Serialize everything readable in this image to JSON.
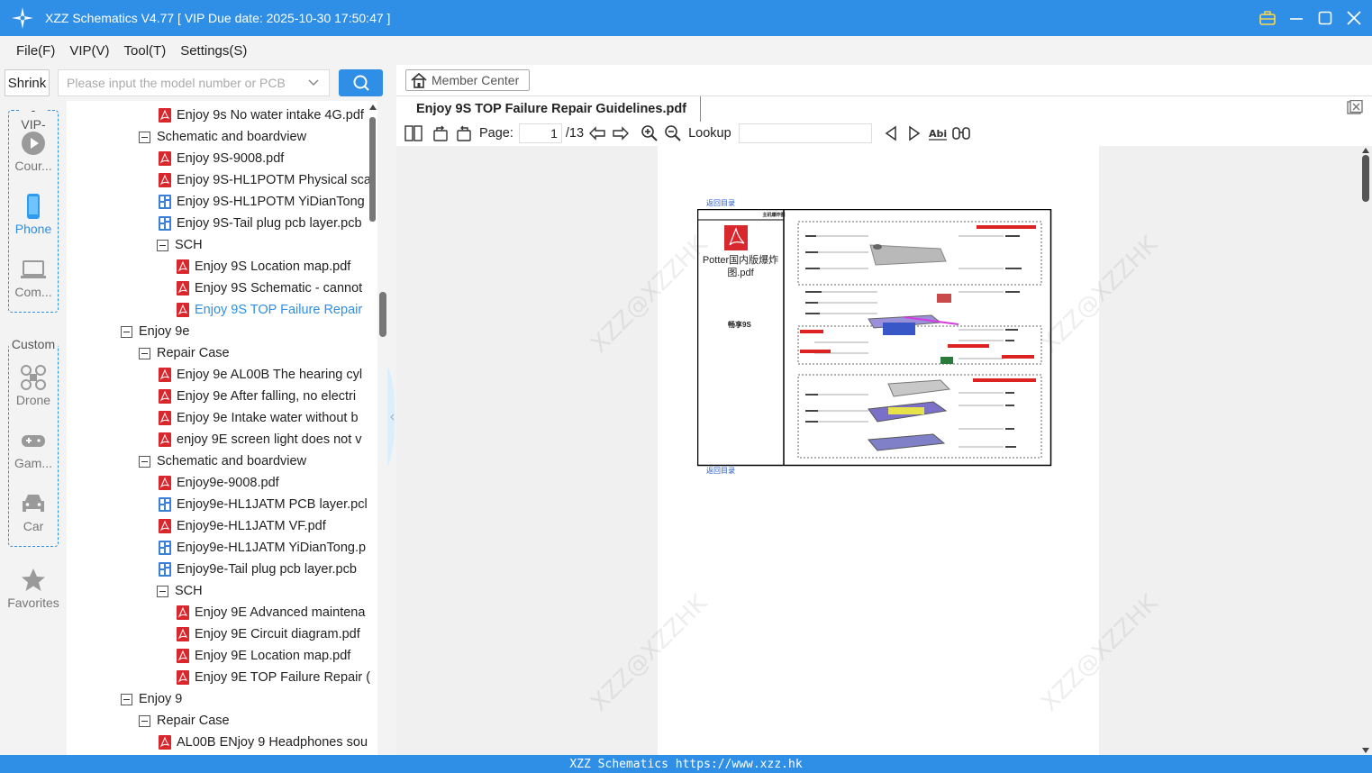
{
  "window": {
    "title": "XZZ Schematics V4.77 [ VIP Due date: 2025-10-30 17:50:47 ]"
  },
  "menu": [
    "File(F)",
    "VIP(V)",
    "Tool(T)",
    "Settings(S)"
  ],
  "search": {
    "shrink_label": "Shrink",
    "placeholder": "Please input the model number or PCB"
  },
  "nav": {
    "vip_label": "-VIP-",
    "custom_label": "Custom",
    "items": [
      "Cour...",
      "Phone",
      "Com...",
      "Drone",
      "Gam...",
      "Car",
      "Favorites"
    ]
  },
  "tree": [
    {
      "label": "Enjoy 9s No water intake 4G.pdf",
      "type": "pdf",
      "level": 2
    },
    {
      "label": "Schematic and boardview",
      "type": "folder",
      "level": 1
    },
    {
      "label": "Enjoy 9S-9008.pdf",
      "type": "pdf",
      "level": 2
    },
    {
      "label": "Enjoy 9S-HL1POTM Physical sca",
      "type": "pdf",
      "level": 2
    },
    {
      "label": "Enjoy 9S-HL1POTM YiDianTong",
      "type": "pcb",
      "level": 2
    },
    {
      "label": "Enjoy 9S-Tail plug pcb layer.pcb",
      "type": "pcb",
      "level": 2
    },
    {
      "label": "SCH",
      "type": "folder",
      "level": 2
    },
    {
      "label": "Enjoy 9S Location map.pdf",
      "type": "pdf",
      "level": 3
    },
    {
      "label": "Enjoy 9S Schematic - cannot",
      "type": "pdf",
      "level": 3
    },
    {
      "label": "Enjoy 9S TOP  Failure Repair",
      "type": "pdf",
      "level": 3,
      "selected": true
    },
    {
      "label": "Enjoy 9e",
      "type": "folder",
      "level": 0
    },
    {
      "label": "Repair Case",
      "type": "folder",
      "level": 1
    },
    {
      "label": "Enjoy 9e AL00B The hearing cyl",
      "type": "pdf",
      "level": 2
    },
    {
      "label": "Enjoy 9e After falling, no electri",
      "type": "pdf",
      "level": 2
    },
    {
      "label": "Enjoy 9e Intake water without b",
      "type": "pdf",
      "level": 2
    },
    {
      "label": "enjoy 9E screen light does not v",
      "type": "pdf",
      "level": 2
    },
    {
      "label": "Schematic and boardview",
      "type": "folder",
      "level": 1
    },
    {
      "label": "Enjoy9e-9008.pdf",
      "type": "pdf",
      "level": 2
    },
    {
      "label": "Enjoy9e-HL1JATM PCB layer.pcl",
      "type": "pcb",
      "level": 2
    },
    {
      "label": "Enjoy9e-HL1JATM VF.pdf",
      "type": "pdf",
      "level": 2
    },
    {
      "label": "Enjoy9e-HL1JATM YiDianTong.p",
      "type": "pcb",
      "level": 2
    },
    {
      "label": "Enjoy9e-Tail plug pcb layer.pcb",
      "type": "pcb",
      "level": 2
    },
    {
      "label": "SCH",
      "type": "folder",
      "level": 2
    },
    {
      "label": "Enjoy 9E Advanced maintena",
      "type": "pdf",
      "level": 3
    },
    {
      "label": "Enjoy 9E Circuit diagram.pdf",
      "type": "pdf",
      "level": 3
    },
    {
      "label": "Enjoy 9E Location map.pdf",
      "type": "pdf",
      "level": 3
    },
    {
      "label": "Enjoy 9E TOP Failure Repair (",
      "type": "pdf",
      "level": 3
    },
    {
      "label": "Enjoy 9",
      "type": "folder",
      "level": 0
    },
    {
      "label": "Repair Case",
      "type": "folder",
      "level": 1
    },
    {
      "label": "AL00B ENjoy 9 Headphones sou",
      "type": "pdf",
      "level": 2
    }
  ],
  "viewer": {
    "member_center": "Member Center",
    "doc_title": "Enjoy 9S TOP  Failure Repair Guidelines.pdf",
    "page_label": "Page:",
    "current_page": "1",
    "total_pages": "/13",
    "lookup_label": "Lookup",
    "page_content": {
      "back_link": "返回目录",
      "header_cell": "主机爆炸图",
      "attachment_name": "Potter国内版爆炸图.pdf",
      "model_label": "畅享9S"
    },
    "watermark": "XZZ@XZZHK"
  },
  "status": {
    "text": "XZZ Schematics https://www.xzz.hk"
  },
  "colors": {
    "accent": "#2f8fe6",
    "pdf_red": "#d9272e"
  }
}
